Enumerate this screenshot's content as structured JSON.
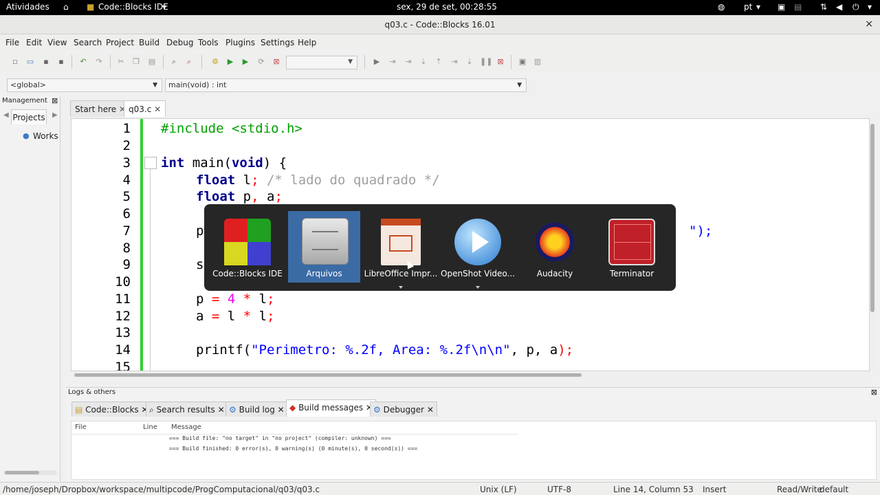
{
  "topbar": {
    "activities": "Atividades",
    "app_menu": "Code::Blocks IDE",
    "clock": "sex, 29 de set, 00:28:55",
    "lang": "pt"
  },
  "window": {
    "title": "q03.c - Code::Blocks 16.01",
    "close": "×"
  },
  "menu": [
    "File",
    "Edit",
    "View",
    "Search",
    "Project",
    "Build",
    "Debug",
    "Tools",
    "Plugins",
    "Settings",
    "Help"
  ],
  "scope": {
    "global": "<global>",
    "func": "main(void) : int"
  },
  "management": {
    "title": "Management",
    "close": "⊠",
    "tab": "Projects",
    "item": "Works"
  },
  "tabs": {
    "start": "Start here",
    "file": "q03.c"
  },
  "code": {
    "line_numbers": [
      "1",
      "2",
      "3",
      "4",
      "5",
      "6",
      "7",
      "8",
      "9",
      "10",
      "11",
      "12",
      "13",
      "14",
      "15"
    ],
    "l1": "#include <stdio.h>",
    "l3_kw": "int",
    "l3_name": " main(",
    "l3_void": "void",
    "l3_rest": ") {",
    "l4_kw": "float",
    "l4_var": " l",
    "l4_semi": ";",
    "l4_cm": " /* lado do quadrado */",
    "l5_kw": "float",
    "l5_var": " p",
    "l5_c": ",",
    "l5_var2": " a",
    "l5_semi": ";",
    "l7_a": "p",
    "l7_b": "\");",
    "l9_a": "s",
    "l11_a": "p ",
    "l11_eq": "=",
    "l11_num": " 4",
    "l11_mul": " *",
    "l11_var": " l",
    "l11_semi": ";",
    "l12_a": "a ",
    "l12_eq": "=",
    "l12_var": " l",
    "l12_mul": " *",
    "l12_var2": " l",
    "l12_semi": ";",
    "l14_fn": "printf(",
    "l14_str": "\"Perimetro: %.2f, Area: %.2f\\n\\n\"",
    "l14_rest": ", p, a",
    "l14_end": ");"
  },
  "logs": {
    "title": "Logs & others",
    "tabs": [
      "Code::Blocks",
      "Search results",
      "Build log",
      "Build messages",
      "Debugger"
    ],
    "headers": {
      "file": "File",
      "line": "Line",
      "message": "Message"
    },
    "rows": [
      "=== Build file: \"no target\" in \"no project\" (compiler: unknown) ===",
      "=== Build finished: 0 error(s), 0 warning(s) (0 minute(s), 0 second(s)) ==="
    ]
  },
  "status": {
    "path": "/home/joseph/Dropbox/workspace/multipcode/ProgComputacional/q03/q03.c",
    "eol": "Unix (LF)",
    "enc": "UTF-8",
    "pos": "Line 14, Column 53",
    "mode": "Insert",
    "rw": "Read/Write",
    "theme": "default"
  },
  "switcher": {
    "apps": [
      "Code::Blocks IDE",
      "Arquivos",
      "LibreOffice Impr...",
      "OpenShot Video...",
      "Audacity",
      "Terminator"
    ],
    "selected": "Arquivos"
  }
}
